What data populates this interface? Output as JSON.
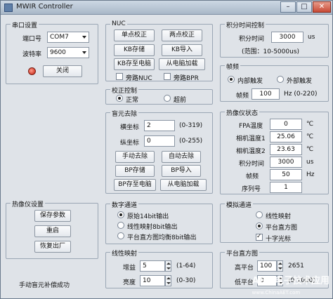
{
  "window": {
    "title": "MWIR Controller"
  },
  "serial": {
    "group": "串口设置",
    "port_label": "端口号",
    "port_value": "COM7",
    "baud_label": "波特率",
    "baud_value": "9600",
    "close_button": "关闭"
  },
  "nuc": {
    "group": "NUC",
    "single_point": "单点校正",
    "two_point": "两点校正",
    "kb_store": "KB存储",
    "kb_import": "KB导入",
    "kb_to_pc": "KB存至电脑",
    "load_from_pc": "从电脑加载",
    "nearby_nuc": "旁路NUC",
    "nearby_bpr": "旁路BPR"
  },
  "calib": {
    "group": "校正控制",
    "normal": "正常",
    "ultra": "超前"
  },
  "blind": {
    "group": "盲元去除",
    "h_label": "横坐标",
    "h_value": "2",
    "h_range": "(0-319)",
    "v_label": "纵坐标",
    "v_value": "0",
    "v_range": "(0-255)",
    "manual_remove": "手动去除",
    "auto_remove": "自动去除",
    "bp_store": "BP存储",
    "bp_import": "BP导入",
    "bp_to_pc": "BP存至电脑",
    "load_from_pc": "从电脑加载"
  },
  "thermal_settings": {
    "group": "热像仪设置",
    "save_params": "保存参数",
    "restart": "重启",
    "factory_reset": "恢复出厂"
  },
  "digital": {
    "group": "数字通道",
    "raw14": "原始14bit输出",
    "linear8": "线性映射8bit输出",
    "hist8": "平台直方图均衡8bit输出"
  },
  "linear_map": {
    "group": "线性映射",
    "gain_label": "增益",
    "gain_value": "5",
    "gain_range": "(1-64)",
    "bright_label": "亮度",
    "bright_value": "10",
    "bright_range": "(0-30)"
  },
  "integration": {
    "group": "积分时间控制",
    "time_label": "积分时间",
    "time_value": "3000",
    "unit": "us",
    "range": "(范围：10-5000us)"
  },
  "frame": {
    "group": "帧频",
    "internal": "内部触发",
    "external": "外部触发",
    "rate_label": "帧频",
    "rate_value": "100",
    "rate_range": "Hz (0-220)"
  },
  "status": {
    "group": "热像仪状态",
    "fpa_label": "FPA温度",
    "fpa_value": "0",
    "fpa_unit": "℃",
    "cam1_label": "相机温度1",
    "cam1_value": "25.06",
    "cam1_unit": "℃",
    "cam2_label": "相机温度2",
    "cam2_value": "23.63",
    "cam2_unit": "℃",
    "int_label": "积分时间",
    "int_value": "3000",
    "int_unit": "us",
    "fr_label": "帧频",
    "fr_value": "50",
    "fr_unit": "Hz",
    "sn_label": "序列号",
    "sn_value": "1"
  },
  "analog": {
    "group": "模拟通道",
    "linear": "线性映射",
    "platform": "平台直方图",
    "crosshair": "十字光标"
  },
  "platform_hist": {
    "group": "平台直方图",
    "high_label": "高平台",
    "high_value": "100",
    "high_extra": "2651",
    "low_label": "低平台",
    "low_value": "0",
    "low_range": "(0-1000)"
  },
  "status_text": "手动盲元补偿成功",
  "watermark": {
    "brand": "AET",
    "cn": "电子技术应用",
    "url": "www.ChinaAET.com"
  }
}
